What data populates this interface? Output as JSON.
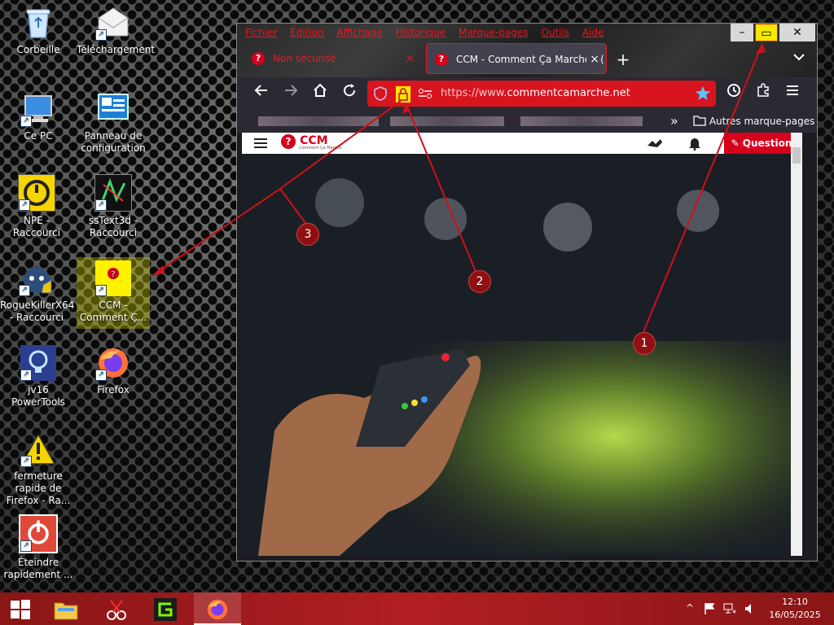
{
  "desktop": {
    "icons": [
      {
        "label": "Corbeille"
      },
      {
        "label": "Téléchargement"
      },
      {
        "label": "Ce PC"
      },
      {
        "label": "Panneau de configuration"
      },
      {
        "label": "NPE - Raccourci"
      },
      {
        "label": "ssText3d - Raccourci"
      },
      {
        "label": "RogueKillerX64 - Raccourci"
      },
      {
        "label": "CCM - Comment Ç..."
      },
      {
        "label": "jv16 PowerTools"
      },
      {
        "label": "Firefox"
      },
      {
        "label": "fermeture rapide de Firefox - Ra..."
      },
      {
        "label": "Éteindre rapidement ..."
      }
    ]
  },
  "browser": {
    "menu": [
      "Fichier",
      "Édition",
      "Affichage",
      "Historique",
      "Marque-pages",
      "Outils",
      "Aide"
    ],
    "tabs": [
      {
        "title": "Non sécurisé",
        "close": "×"
      },
      {
        "title": "CCM - Comment Ça Marche - (",
        "close": "×"
      }
    ],
    "new_tab": "+",
    "window_controls": {
      "minimize": "–",
      "maximize": "▭",
      "close": "✕"
    },
    "url": "https://www.commentcamarche.net",
    "url_prefix": "https://www.",
    "url_domain": "commentcamarche.net",
    "bookmarks": {
      "more": "»",
      "other": "Autres marque-pages"
    },
    "page": {
      "logo": "CCM",
      "logo_sub": "Comment Ça Marche",
      "question_button": "Question"
    }
  },
  "annotations": {
    "markers": [
      "1",
      "2",
      "3"
    ],
    "color": "#d0101a"
  },
  "taskbar": {
    "time": "12:10",
    "date": "16/05/2025",
    "tray_up": "^"
  },
  "colors": {
    "accent": "#e01b24",
    "taskbar": "#9e1b1b",
    "url_bar": "#d8141f"
  }
}
